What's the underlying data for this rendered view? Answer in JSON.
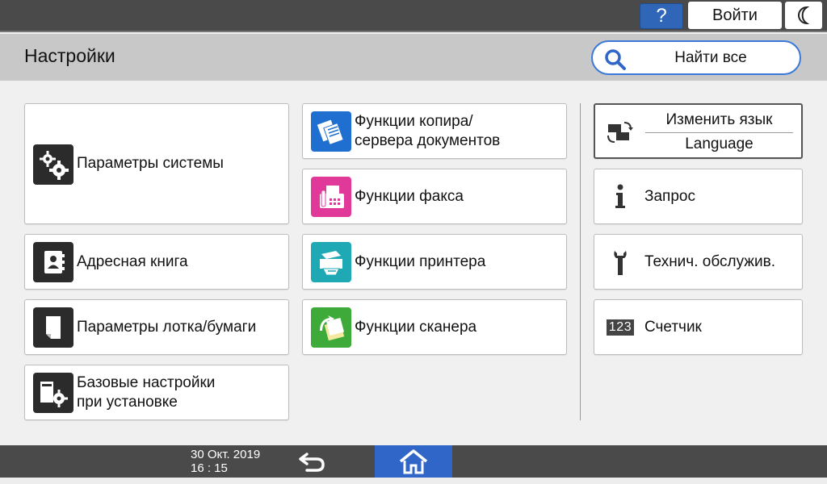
{
  "topbar": {
    "help_label": "?",
    "login_label": "Войти",
    "sleep_icon": "moon-icon"
  },
  "header": {
    "title": "Настройки",
    "search_label": "Найти все",
    "search_icon": "search-icon"
  },
  "tiles": {
    "system": {
      "label": "Параметры системы",
      "icon": "gears-icon"
    },
    "address": {
      "label": "Адресная книга",
      "icon": "address-book-icon"
    },
    "tray": {
      "label": "Параметры лотка/бумаги",
      "icon": "paper-icon"
    },
    "basic": {
      "label": "Базовые настройки\nпри установке",
      "icon": "machine-gear-icon"
    },
    "copier": {
      "label": "Функции копира/\nсервера документов",
      "icon": "copier-icon"
    },
    "fax": {
      "label": "Функции факса",
      "icon": "fax-icon"
    },
    "printer": {
      "label": "Функции принтера",
      "icon": "printer-icon"
    },
    "scanner": {
      "label": "Функции сканера",
      "icon": "scanner-icon"
    },
    "language": {
      "line1": "Изменить язык",
      "line2": "Language",
      "icon": "language-switch-icon"
    },
    "inquiry": {
      "label": "Запрос",
      "icon": "info-icon"
    },
    "maintenance": {
      "label": "Технич. обслужив.",
      "icon": "wrench-icon"
    },
    "counter": {
      "label": "Счетчик",
      "icon": "counter-123-icon",
      "icon_text": "123"
    }
  },
  "bottombar": {
    "date": "30 Окт. 2019",
    "time": "16 : 15",
    "back_icon": "back-arrow-icon",
    "home_icon": "home-icon"
  },
  "colors": {
    "accent_blue": "#2f66c8",
    "fax_pink": "#e0399a",
    "printer_teal": "#1fa9b5",
    "scanner_green": "#3eaa3a"
  }
}
